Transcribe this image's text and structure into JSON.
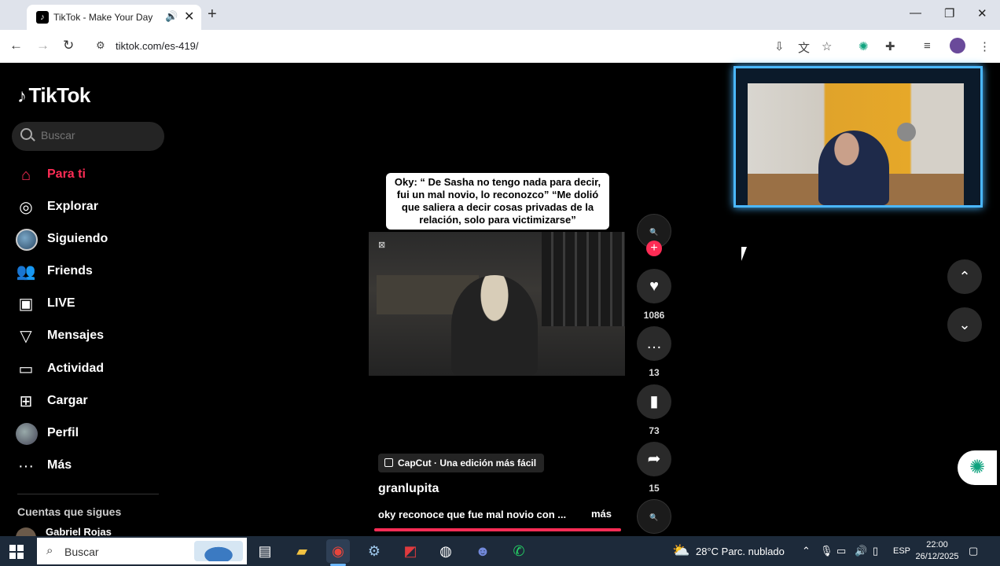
{
  "browser": {
    "tab_title": "TikTok - Make Your Day",
    "url": "tiktok.com/es-419/"
  },
  "tiktok": {
    "logo_text": "TikTok",
    "search_placeholder": "Buscar",
    "nav": [
      {
        "label": "Para ti",
        "icon": "home-icon",
        "active": true
      },
      {
        "label": "Explorar",
        "icon": "compass-icon"
      },
      {
        "label": "Siguiendo",
        "icon": "avatar"
      },
      {
        "label": "Friends",
        "icon": "friends-icon"
      },
      {
        "label": "LIVE",
        "icon": "live-icon"
      },
      {
        "label": "Mensajes",
        "icon": "send-icon"
      },
      {
        "label": "Actividad",
        "icon": "activity-icon"
      },
      {
        "label": "Cargar",
        "icon": "upload-icon"
      },
      {
        "label": "Perfil",
        "icon": "avatar"
      },
      {
        "label": "Más",
        "icon": "more-icon"
      }
    ],
    "following_header": "Cuentas que sigues",
    "following": [
      {
        "name": "Gabriel Rojas"
      }
    ],
    "video": {
      "caption": "Oky: “ De Sasha no tengo nada para decir, fui un mal novio, lo reconozco” “Me dolió que saliera a decir cosas privadas de la relación, solo para victimizarse”",
      "editor_badge": "CapCut · Una edición más fácil",
      "author": "granlupita",
      "description": "oky reconoce que fue mal novio con ...",
      "more": "más",
      "likes": "1086",
      "comments": "13",
      "saves": "73",
      "shares": "15",
      "progress": 1.0
    }
  },
  "taskbar": {
    "search_text": "Buscar",
    "weather": "28°C  Parc. nublado",
    "lang": "ESP",
    "time": "22:00",
    "date": "26/12/2025"
  },
  "colors": {
    "accent": "#fe2c55",
    "webcam_border": "#4ab7ff",
    "taskbar": "#1d2a3a"
  }
}
